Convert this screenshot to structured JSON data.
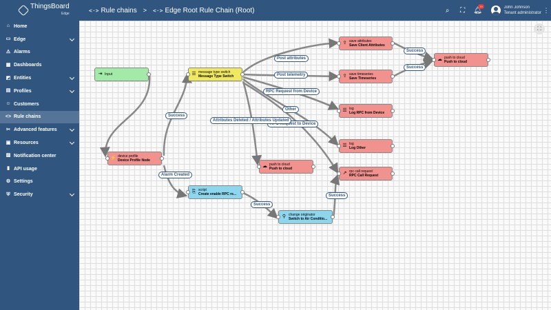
{
  "app": {
    "name": "ThingsBoard",
    "sub": "Edge"
  },
  "sidebar": {
    "items": [
      {
        "label": "Home",
        "icon": "⌂"
      },
      {
        "label": "Edge",
        "icon": "▭"
      },
      {
        "label": "Alarms",
        "icon": "⚠"
      },
      {
        "label": "Dashboards",
        "icon": "▦"
      },
      {
        "label": "Entities",
        "icon": "◩"
      },
      {
        "label": "Profiles",
        "icon": "▤"
      },
      {
        "label": "Customers",
        "icon": "☺"
      },
      {
        "label": "Rule chains",
        "icon": "<>"
      },
      {
        "label": "Advanced features",
        "icon": "✂"
      },
      {
        "label": "Resources",
        "icon": "▣"
      },
      {
        "label": "Notification center",
        "icon": "▨"
      },
      {
        "label": "API usage",
        "icon": "▮"
      },
      {
        "label": "Settings",
        "icon": "⚙"
      },
      {
        "label": "Security",
        "icon": "⛨"
      }
    ]
  },
  "header": {
    "breadcrumb": [
      "Rule chains",
      "Edge Root Rule Chain (Root)"
    ],
    "breadcrumb_icon": "<·>",
    "separator": ">",
    "notifications_count": "19",
    "user": {
      "name": "John Johnson",
      "role": "Tenant administrator"
    }
  },
  "nodes": [
    {
      "type": "",
      "name": "Input",
      "color": "green",
      "icon": "⇥"
    },
    {
      "type": "message type switch",
      "name": "Message Type Switch",
      "color": "yellow",
      "icon": "☰"
    },
    {
      "type": "device profile",
      "name": "Device Profile Node",
      "color": "red",
      "icon": "⚡"
    },
    {
      "type": "save attributes",
      "name": "Save Client Attributes",
      "color": "red",
      "icon": "⇪"
    },
    {
      "type": "save timeseries",
      "name": "Save Timeseries",
      "color": "red",
      "icon": "⇪"
    },
    {
      "type": "push to cloud",
      "name": "Push to cloud",
      "color": "red",
      "icon": "☁"
    },
    {
      "type": "log",
      "name": "Log RPC from Device",
      "color": "red",
      "icon": "☰"
    },
    {
      "type": "log",
      "name": "Log Other",
      "color": "red",
      "icon": "☰"
    },
    {
      "type": "push to cloud",
      "name": "Push to cloud",
      "color": "red",
      "icon": "☁"
    },
    {
      "type": "rpc call request",
      "name": "RPC Call Request",
      "color": "red",
      "icon": "↗"
    },
    {
      "type": "script",
      "name": "Create enable RPC re...",
      "color": "blue",
      "icon": "⎘"
    },
    {
      "type": "change originator",
      "name": "Switch to Air Conditio...",
      "color": "blue",
      "icon": "⚲"
    }
  ],
  "edge_labels": [
    "Post attributes",
    "Post telemetry",
    "RPC Request from Device",
    "Other",
    "Attributes Deleted / Attributes Updated",
    "RPC Request to Device",
    "Success",
    "Alarm Created",
    "Success",
    "Success",
    "Success",
    "Success"
  ]
}
